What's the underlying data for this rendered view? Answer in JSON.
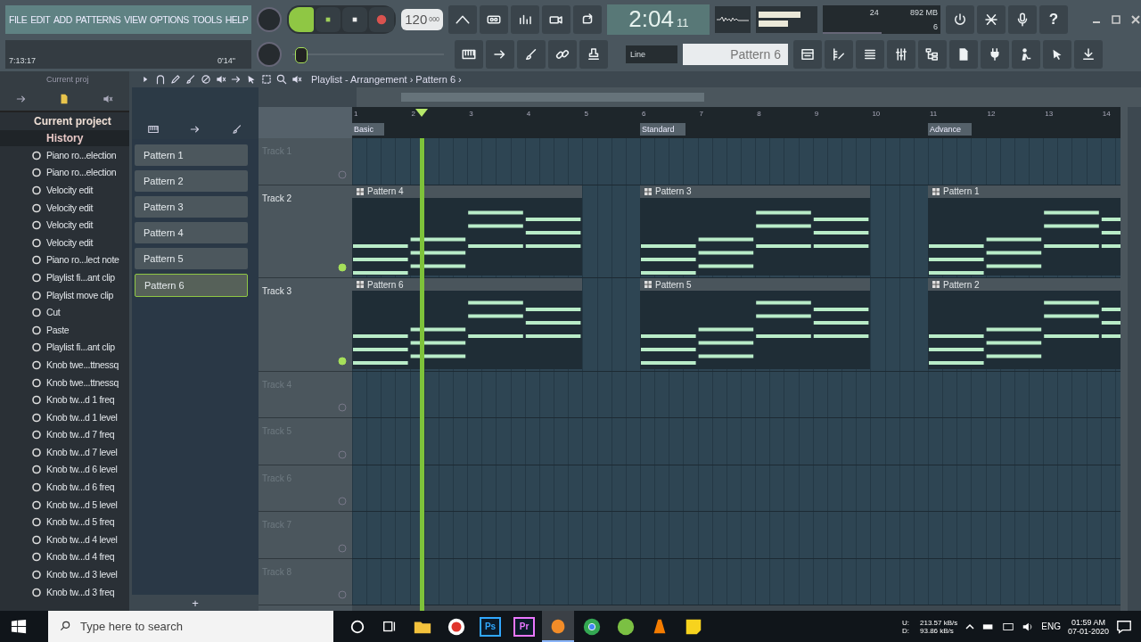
{
  "menu": [
    "FILE",
    "EDIT",
    "ADD",
    "PATTERNS",
    "VIEW",
    "OPTIONS",
    "TOOLS",
    "HELP"
  ],
  "hint_bar": {
    "left": "7:13:17",
    "right": "0'14\""
  },
  "tempo": {
    "value": "120",
    "fraction": "000"
  },
  "toolbar_row1": [
    {
      "kind": "peak"
    },
    {
      "kind": "tape"
    },
    {
      "kind": "bars"
    },
    {
      "kind": "camera"
    },
    {
      "kind": "loop"
    }
  ],
  "time": {
    "main": "2:04",
    "sub": "11"
  },
  "cpu": {
    "value": "24",
    "memory": "892 MB",
    "polyphony": "6"
  },
  "toolbar_status": [
    {
      "kind": "power"
    },
    {
      "kind": "cross"
    },
    {
      "kind": "mic"
    },
    {
      "kind": "help",
      "label": "?"
    }
  ],
  "pitch": {
    "level": 0.05
  },
  "toolbar_row2": [
    {
      "kind": "piano"
    },
    {
      "kind": "arrow"
    },
    {
      "kind": "brush"
    },
    {
      "kind": "link"
    },
    {
      "kind": "bell"
    }
  ],
  "snap": "Line",
  "pattern": "Pattern 6",
  "toolbar_row3": [
    {
      "kind": "rack"
    },
    {
      "kind": "pianoroll"
    },
    {
      "kind": "list"
    },
    {
      "kind": "mixer"
    },
    {
      "kind": "branch"
    },
    {
      "kind": "document"
    },
    {
      "kind": "plug"
    },
    {
      "kind": "person"
    },
    {
      "kind": "pointer"
    },
    {
      "kind": "download"
    }
  ],
  "browser": {
    "title": "Current proj",
    "root": "Current project",
    "folder": "History",
    "items": [
      "Piano ro...election",
      "Piano ro...election",
      "Velocity edit",
      "Velocity edit",
      "Velocity edit",
      "Velocity edit",
      "Piano ro...lect note",
      "Playlist fi...ant clip",
      "Playlist move clip",
      "Cut",
      "Paste",
      "Playlist fi...ant clip",
      "Knob twe...ttnessq",
      "Knob twe...ttnessq",
      "Knob tw...d 1 freq",
      "Knob tw...d 1 level",
      "Knob tw...d 7 freq",
      "Knob tw...d 7 level",
      "Knob tw...d 6 level",
      "Knob tw...d 6 freq",
      "Knob tw...d 5 level",
      "Knob tw...d 5 freq",
      "Knob tw...d 4 level",
      "Knob tw...d 4 freq",
      "Knob tw...d 3 level",
      "Knob tw...d 3 freq"
    ]
  },
  "playlist": {
    "breadcrumb": "Playlist - Arrangement › Pattern 6 ›",
    "toolbar": [
      {
        "kind": "play"
      },
      {
        "kind": "magnet"
      },
      {
        "kind": "pencil"
      },
      {
        "kind": "brush"
      },
      {
        "kind": "slash"
      },
      {
        "kind": "speaker"
      },
      {
        "kind": "arrow"
      },
      {
        "kind": "pointer"
      },
      {
        "kind": "select"
      },
      {
        "kind": "zoom"
      },
      {
        "kind": "speaker"
      }
    ],
    "patterns": [
      {
        "label": "Pattern 1",
        "selected": false
      },
      {
        "label": "Pattern 2",
        "selected": false
      },
      {
        "label": "Pattern 3",
        "selected": false
      },
      {
        "label": "Pattern 4",
        "selected": false
      },
      {
        "label": "Pattern 5",
        "selected": false
      },
      {
        "label": "Pattern 6",
        "selected": true
      }
    ],
    "add_label": "+",
    "ruler": [
      "1",
      "2",
      "3",
      "4",
      "5",
      "6",
      "7",
      "8",
      "9",
      "10",
      "11",
      "12",
      "13",
      "14"
    ],
    "markers": [
      "Basic",
      "Standard",
      "Advance"
    ],
    "playhead": {
      "level": 0.09
    },
    "tracks": [
      {
        "label": "Track 1",
        "active": false
      },
      {
        "label": "Track 2",
        "active": true,
        "clips": [
          "Pattern 4",
          "Pattern 3",
          "Pattern 1"
        ]
      },
      {
        "label": "Track 3",
        "active": true,
        "clips": [
          "Pattern 6",
          "Pattern 5",
          "Pattern 2"
        ]
      },
      {
        "label": "Track 4",
        "active": false
      },
      {
        "label": "Track 5",
        "active": false
      },
      {
        "label": "Track 6",
        "active": false
      },
      {
        "label": "Track 7",
        "active": false
      },
      {
        "label": "Track 8",
        "active": false
      }
    ]
  },
  "taskbar": {
    "search_placeholder": "Type here to search",
    "apps": [
      {
        "kind": "folder",
        "color": "#f3c23c",
        "selected": false
      },
      {
        "kind": "record",
        "color": "#e0342c",
        "selected": false
      },
      {
        "kind": "letter",
        "label": "Ps",
        "color": "#31a8ff",
        "selected": false
      },
      {
        "kind": "letter",
        "label": "Pr",
        "color": "#ea77ff",
        "selected": false
      },
      {
        "kind": "fruit",
        "color": "#f28c28",
        "selected": true
      },
      {
        "kind": "globe",
        "color": "#34a853",
        "selected": false
      },
      {
        "kind": "leaf",
        "color": "#7bc043",
        "selected": false
      },
      {
        "kind": "cone",
        "color": "#f57c00",
        "selected": false
      },
      {
        "kind": "note",
        "color": "#f7d31e",
        "selected": false
      }
    ],
    "net": [
      {
        "label": "U:",
        "value": "213.57 kB/s"
      },
      {
        "label": "D:",
        "value": "93.86 kB/s"
      }
    ],
    "language": "ENG",
    "time": "01:59 AM",
    "date": "07-01-2020"
  }
}
